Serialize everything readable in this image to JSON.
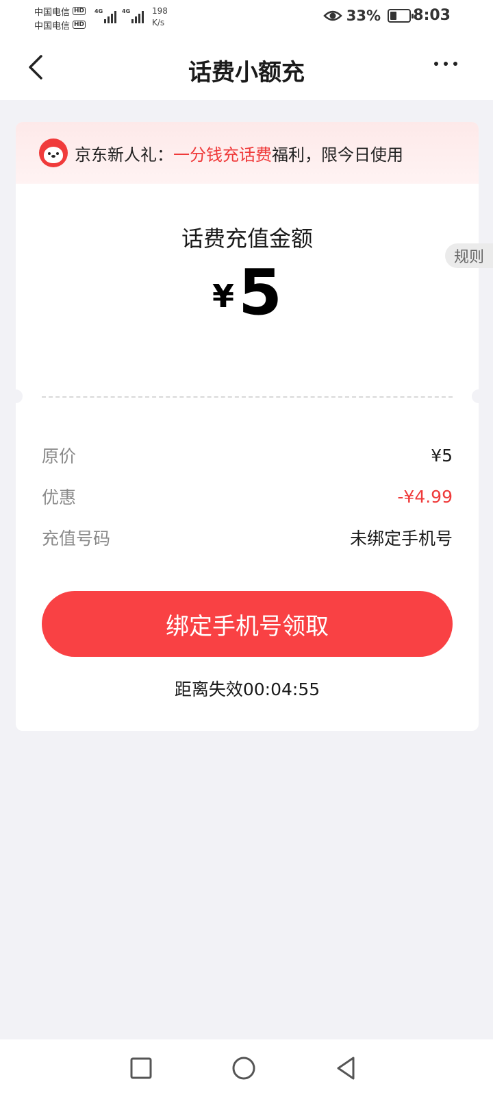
{
  "status": {
    "carriers": [
      {
        "name": "中国电信",
        "badge": "HD"
      },
      {
        "name": "中国电信",
        "badge": "HD"
      }
    ],
    "network": [
      "4G",
      "4G"
    ],
    "speed_value": "198",
    "speed_unit": "K/s",
    "battery_percent": "33%",
    "battery_level": 0.33,
    "time": "8:03"
  },
  "nav": {
    "title": "话费小额充"
  },
  "banner": {
    "prefix": "京东新人礼：",
    "highlight": "一分钱充话费",
    "suffix": "福利，限今日使用"
  },
  "recharge": {
    "label": "话费充值金额",
    "currency": "¥",
    "amount": "5"
  },
  "rule_tab": "规则",
  "details": [
    {
      "key": "原价",
      "value": "¥5",
      "style": "normal"
    },
    {
      "key": "优惠",
      "value": "-¥4.99",
      "style": "red"
    },
    {
      "key": "充值号码",
      "value": "未绑定手机号",
      "style": "normal"
    }
  ],
  "cta_label": "绑定手机号领取",
  "countdown_label": "距离失效",
  "countdown_time": "00:04:55",
  "colors": {
    "accent": "#f94144",
    "highlight": "#ef3a3a",
    "background": "#f2f2f6"
  },
  "icons": {
    "back": "chevron-left-icon",
    "more": "more-dots-icon",
    "home": "circle-home-icon",
    "recents": "square-recents-icon",
    "back_sys": "triangle-back-icon"
  }
}
